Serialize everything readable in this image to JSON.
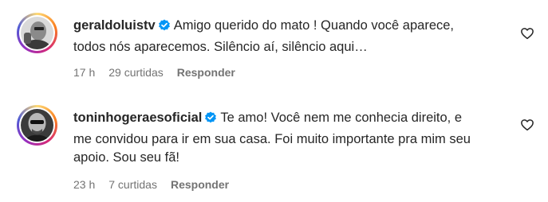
{
  "comments": [
    {
      "username": "geraldoluistv",
      "text": "Amigo querido do mato ! Quando você aparece, todos nós aparecemos. Silêncio aí, silêncio aqui…",
      "time": "17 h",
      "likes": "29 curtidas",
      "reply_label": "Responder"
    },
    {
      "username": "toninhogeraesoficial",
      "text": "Te amo! Você nem me conhecia direito, e me convidou para ir em sua casa. Foi muito importante pra mim seu apoio. Sou seu fã!",
      "time": "23 h",
      "likes": "7 curtidas",
      "reply_label": "Responder"
    }
  ],
  "colors": {
    "verified": "#0095f6",
    "meta_text": "#737373",
    "body_text": "#262626"
  },
  "icons": {
    "verified": "verified-badge-icon",
    "like": "heart-outline-icon"
  }
}
